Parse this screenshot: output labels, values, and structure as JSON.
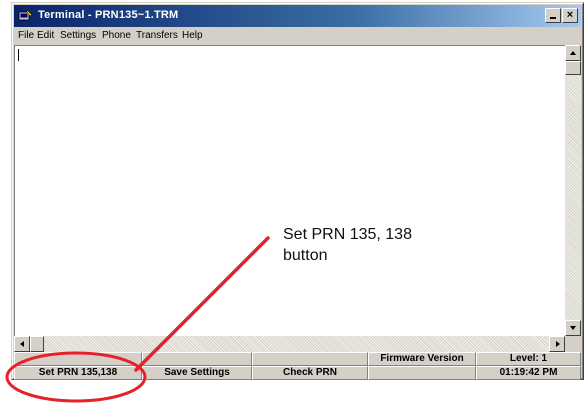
{
  "window": {
    "title": "Terminal - PRN135~1.TRM",
    "icon": "terminal-app-icon",
    "buttons": {
      "minimize": "minimize-icon",
      "close": "close-icon",
      "close_glyph": "×"
    }
  },
  "menu": {
    "items": [
      "File",
      "Edit",
      "Settings",
      "Phone",
      "Transfers",
      "Help"
    ]
  },
  "terminal": {
    "content": ""
  },
  "function_keys": {
    "row1": [
      "",
      "",
      "",
      "",
      "Firmware Version",
      "Level: 1"
    ],
    "row2": [
      "Set PRN 135,138",
      "Save Settings",
      "Check PRN",
      "",
      "",
      "01:19:42 PM"
    ]
  },
  "annotation": {
    "text_line1": "Set PRN 135, 138",
    "text_line2": "button",
    "color": "#e8202a"
  }
}
